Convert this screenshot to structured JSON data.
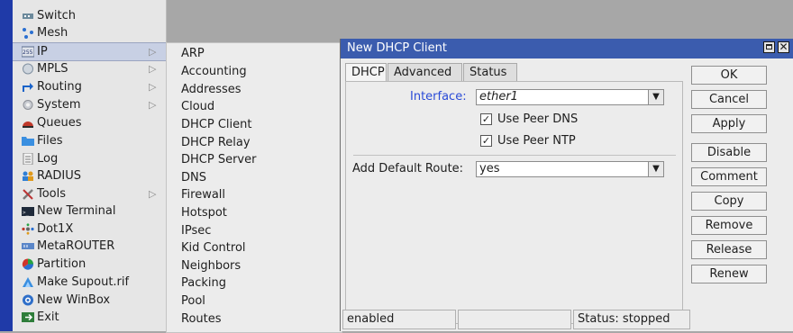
{
  "sidebar": {
    "items": [
      {
        "label": "Switch",
        "icon": "switch-icon"
      },
      {
        "label": "Mesh",
        "icon": "mesh-icon"
      },
      {
        "label": "IP",
        "icon": "ip-icon",
        "arrow": "▷"
      },
      {
        "label": "MPLS",
        "icon": "mpls-icon",
        "arrow": "▷"
      },
      {
        "label": "Routing",
        "icon": "routing-icon",
        "arrow": "▷"
      },
      {
        "label": "System",
        "icon": "system-icon",
        "arrow": "▷"
      },
      {
        "label": "Queues",
        "icon": "queues-icon"
      },
      {
        "label": "Files",
        "icon": "files-icon"
      },
      {
        "label": "Log",
        "icon": "log-icon"
      },
      {
        "label": "RADIUS",
        "icon": "radius-icon"
      },
      {
        "label": "Tools",
        "icon": "tools-icon",
        "arrow": "▷"
      },
      {
        "label": "New Terminal",
        "icon": "terminal-icon"
      },
      {
        "label": "Dot1X",
        "icon": "dot1x-icon"
      },
      {
        "label": "MetaROUTER",
        "icon": "metarouter-icon"
      },
      {
        "label": "Partition",
        "icon": "partition-icon"
      },
      {
        "label": "Make Supout.rif",
        "icon": "supout-icon"
      },
      {
        "label": "New WinBox",
        "icon": "winbox-icon"
      },
      {
        "label": "Exit",
        "icon": "exit-icon"
      }
    ]
  },
  "submenu": {
    "items": [
      "ARP",
      "Accounting",
      "Addresses",
      "Cloud",
      "DHCP Client",
      "DHCP Relay",
      "DHCP Server",
      "DNS",
      "Firewall",
      "Hotspot",
      "IPsec",
      "Kid Control",
      "Neighbors",
      "Packing",
      "Pool",
      "Routes"
    ]
  },
  "dialog": {
    "title": "New DHCP Client",
    "tabs": [
      "DHCP",
      "Advanced",
      "Status"
    ],
    "interface_label": "Interface:",
    "interface_value": "ether1",
    "use_peer_dns_label": "Use Peer DNS",
    "use_peer_ntp_label": "Use Peer NTP",
    "add_default_route_label": "Add Default Route:",
    "add_default_route_value": "yes",
    "buttons": [
      "OK",
      "Cancel",
      "Apply",
      "Disable",
      "Comment",
      "Copy",
      "Remove",
      "Release",
      "Renew"
    ],
    "status": {
      "state": "enabled",
      "middle": "",
      "status": "Status: stopped"
    }
  },
  "colors": {
    "titlebar": "#3b5cae",
    "accent_blue": "#2a4bd7",
    "left_strip": "#1f3aa8"
  }
}
